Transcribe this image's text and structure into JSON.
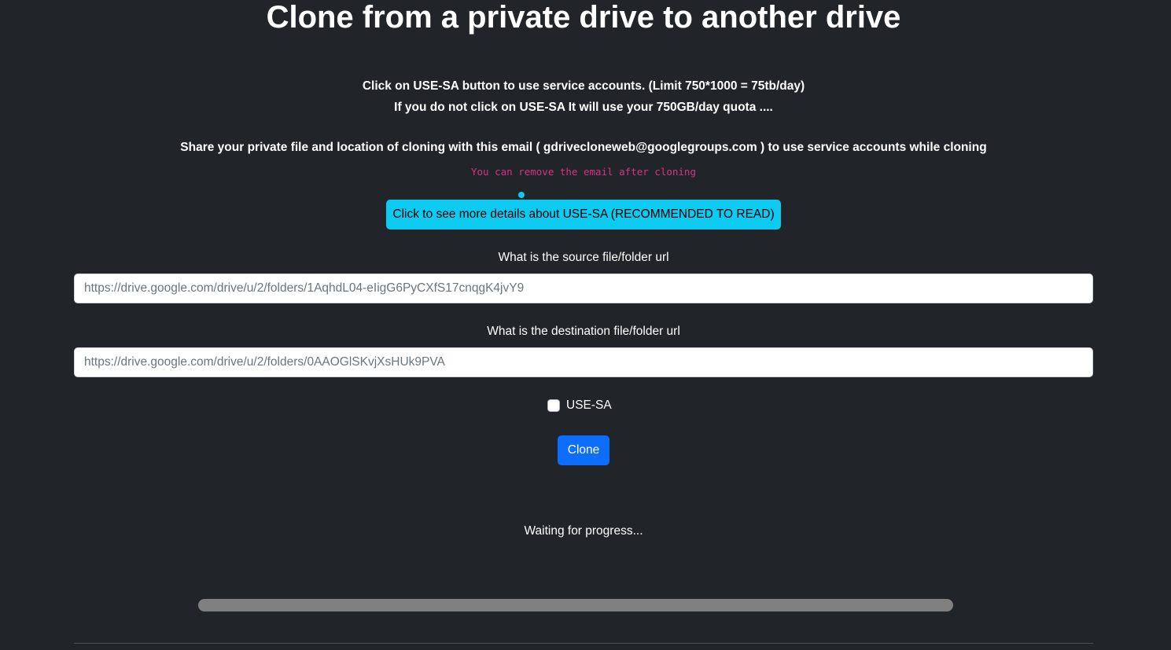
{
  "header": {
    "title": "Clone from a private drive to another drive"
  },
  "info": {
    "line1": "Click on USE-SA button to use service accounts. (Limit 750*1000 = 75tb/day)",
    "line2": "If you do not click on USE-SA It will use your 750GB/day quota ....",
    "line3": "Share your private file and location of cloning with this email ( gdrivecloneweb@googlegroups.com ) to use service accounts while cloning",
    "note": "You can remove the email after cloning"
  },
  "details_button": {
    "label": "Click to see more details about USE-SA (RECOMMENDED TO READ)"
  },
  "source": {
    "label": "What is the source file/folder url",
    "placeholder": "https://drive.google.com/drive/u/2/folders/1AqhdL04-eIigG6PyCXfS17cnqgK4jvY9",
    "value": ""
  },
  "destination": {
    "label": "What is the destination file/folder url",
    "placeholder": "https://drive.google.com/drive/u/2/folders/0AAOGlSKvjXsHUk9PVA",
    "value": ""
  },
  "use_sa": {
    "label": "USE-SA",
    "checked": false
  },
  "clone_button": {
    "label": "Clone"
  },
  "progress": {
    "status": "Waiting for progress...",
    "fraction": 0
  },
  "colors": {
    "background": "#212529",
    "info_button": "#0dcaf0",
    "primary_button": "#0d6efd",
    "note_text": "#d63384",
    "progress_track": "#808080"
  }
}
